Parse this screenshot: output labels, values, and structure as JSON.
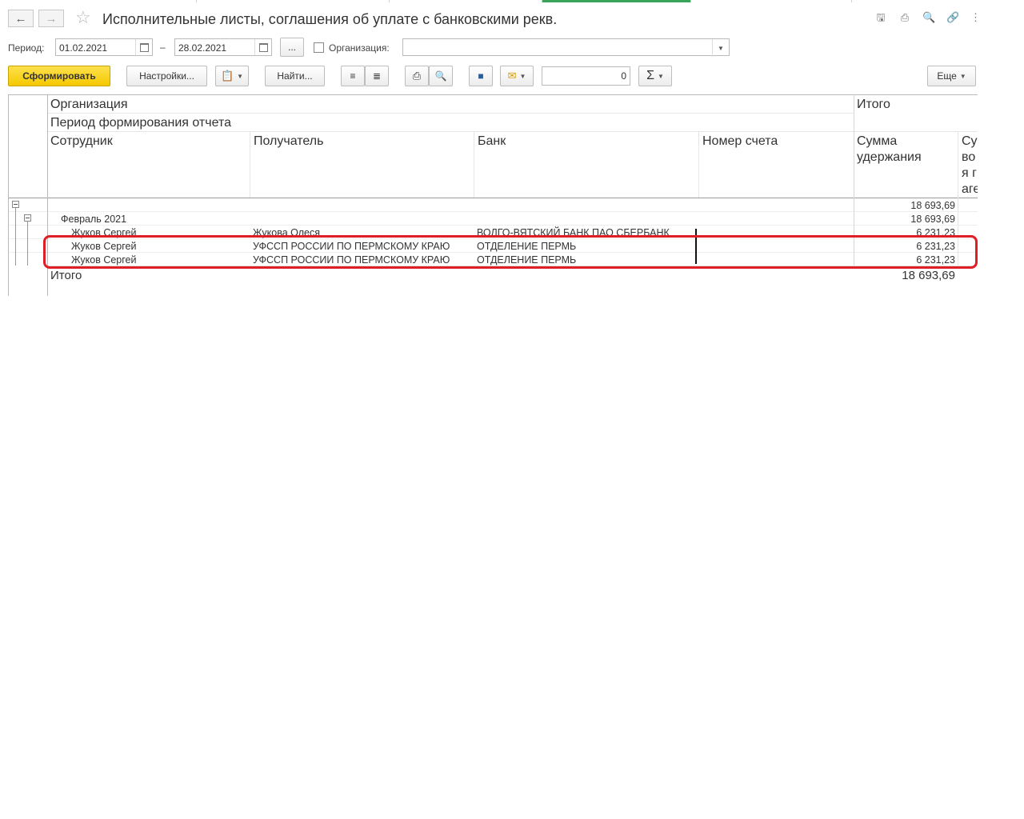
{
  "window": {
    "title": "Исполнительные листы, соглашения об уплате с банковскими рекв.",
    "nav": {
      "back_icon": "arrow-left-icon",
      "forward_icon": "arrow-right-icon",
      "favorite_icon": "star-icon"
    },
    "tools": [
      "save-icon",
      "print-icon",
      "preview-icon",
      "link-icon",
      "more-vert-icon"
    ]
  },
  "filters": {
    "period_label": "Период:",
    "date_from": "01.02.2021",
    "dash": "–",
    "date_to": "28.02.2021",
    "choose_period": "...",
    "org_label": "Организация:",
    "org_value": ""
  },
  "toolbar": {
    "generate": "Сформировать",
    "settings": "Настройки...",
    "find": "Найти...",
    "count_value": "0",
    "sum_symbol": "Σ",
    "more": "Еще"
  },
  "report": {
    "headers": {
      "organization": "Организация",
      "period": "Период формирования отчета",
      "employee": "Сотрудник",
      "recipient": "Получатель",
      "bank": "Банк",
      "account": "Номер счета",
      "total": "Итого",
      "deduction_line1": "Сумма",
      "deduction_line2": "удержания",
      "cut_line1": "Су",
      "cut_line2": "во",
      "cut_line3": "я г",
      "cut_line4": "аге"
    },
    "org_total": "18 693,69",
    "group": {
      "label": "Февраль 2021",
      "total": "18 693,69"
    },
    "rows": [
      {
        "employee": "Жуков Сергей",
        "recipient": "Жукова Олеся",
        "bank": "ВОЛГО-ВЯТСКИЙ БАНК ПАО СБЕРБАНК",
        "amount": "6 231,23"
      },
      {
        "employee": "Жуков Сергей",
        "recipient": "УФССП РОССИИ ПО ПЕРМСКОМУ КРАЮ",
        "bank": "ОТДЕЛЕНИЕ ПЕРМЬ",
        "amount": "6 231,23"
      },
      {
        "employee": "Жуков Сергей",
        "recipient": "УФССП РОССИИ ПО ПЕРМСКОМУ КРАЮ",
        "bank": "ОТДЕЛЕНИЕ ПЕРМЬ",
        "amount": "6 231,23"
      }
    ],
    "grand_total_label": "Итого",
    "grand_total": "18 693,69"
  },
  "colors": {
    "primary_button": "#f4c800",
    "highlight_stroke": "#e01e25",
    "active_tab": "#3aa35a"
  }
}
